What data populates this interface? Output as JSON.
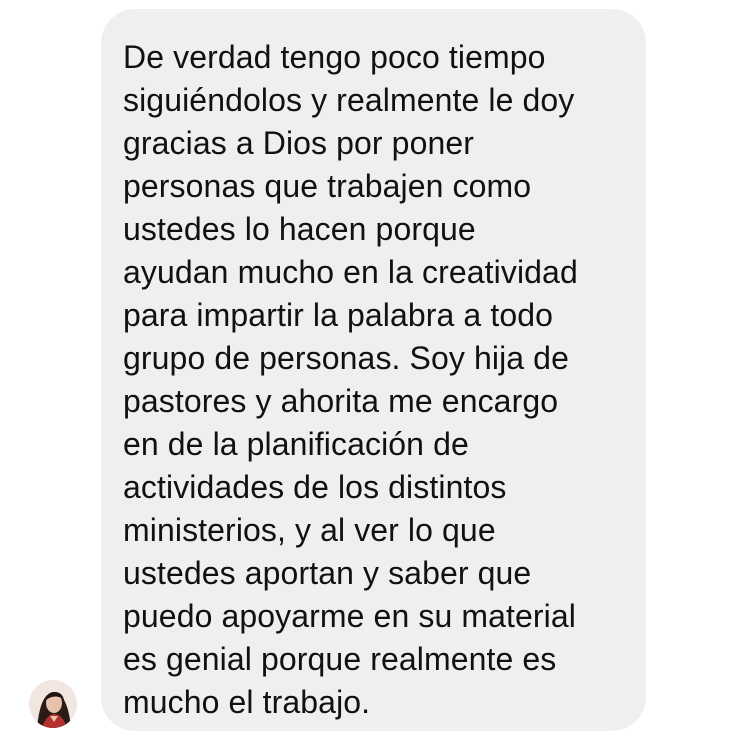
{
  "message": {
    "lines": [
      "De verdad tengo poco tiempo",
      "siguiéndolos y realmente le doy",
      "gracias a Dios por poner",
      "personas que trabajen como",
      "ustedes lo hacen porque",
      "ayudan mucho en la creatividad",
      "para impartir la palabra a todo",
      "grupo de personas. Soy hija de",
      "pastores y ahorita me encargo",
      "en de la planificación de",
      "actividades de los distintos",
      "ministerios, y al ver lo que",
      "ustedes aportan y saber que",
      "puedo apoyarme en su material",
      "es genial porque realmente es",
      "mucho el trabajo."
    ]
  },
  "colors": {
    "bubble_background": "#efefef",
    "text": "#111111",
    "page_background": "#ffffff"
  },
  "sender": {
    "avatar_icon": "profile-photo-icon"
  }
}
